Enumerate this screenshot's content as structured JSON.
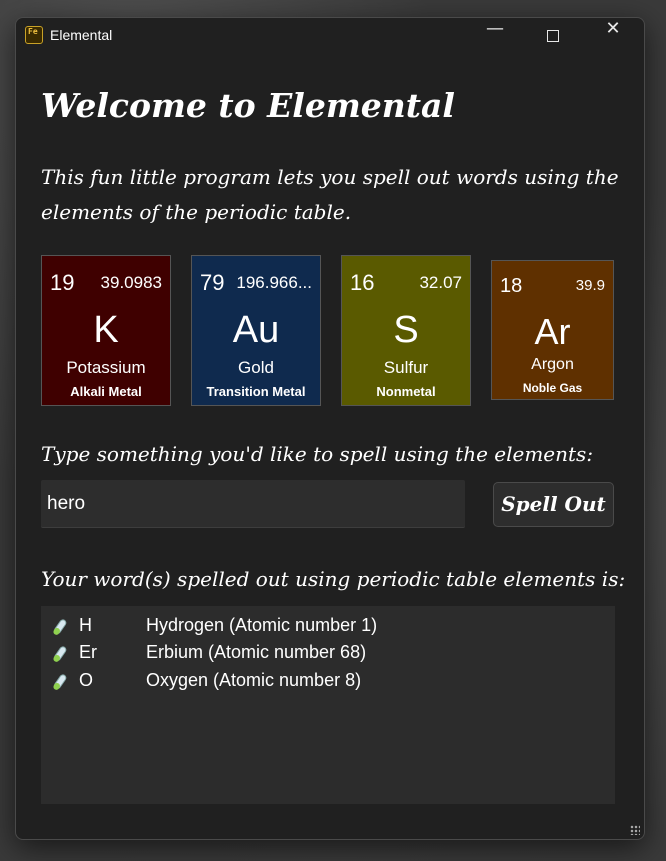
{
  "window": {
    "title": "Elemental",
    "app_icon": "Fe",
    "controls": {
      "minimize": "—",
      "close": "✕"
    }
  },
  "welcome_heading": "Welcome to Elemental",
  "intro_text": "This fun little program lets you spell out words using the elements of the periodic table.",
  "tiles": [
    {
      "number": "19",
      "mass": "39.0983",
      "symbol": "K",
      "name": "Potassium",
      "category": "Alkali Metal",
      "color": "#3f0000"
    },
    {
      "number": "79",
      "mass": "196.966...",
      "symbol": "Au",
      "name": "Gold",
      "category": "Transition Metal",
      "color": "#0f2a4e"
    },
    {
      "number": "16",
      "mass": "32.07",
      "symbol": "S",
      "name": "Sulfur",
      "category": "Nonmetal",
      "color": "#5a5a00"
    },
    {
      "number": "18",
      "mass": "39.9",
      "symbol": "Ar",
      "name": "Argon",
      "category": "Noble Gas",
      "color": "#5f3000"
    }
  ],
  "input_prompt": "Type something you'd like to spell using the elements:",
  "input_value": "hero",
  "spell_button_label": "Spell Out",
  "result_label": "Your word(s) spelled out using periodic table elements is:",
  "results": [
    {
      "icon": "test-tube-icon",
      "symbol": "H",
      "description": "Hydrogen (Atomic number 1)"
    },
    {
      "icon": "test-tube-icon",
      "symbol": "Er",
      "description": "Erbium (Atomic number 68)"
    },
    {
      "icon": "test-tube-icon",
      "symbol": "O",
      "description": "Oxygen (Atomic number 8)"
    }
  ]
}
